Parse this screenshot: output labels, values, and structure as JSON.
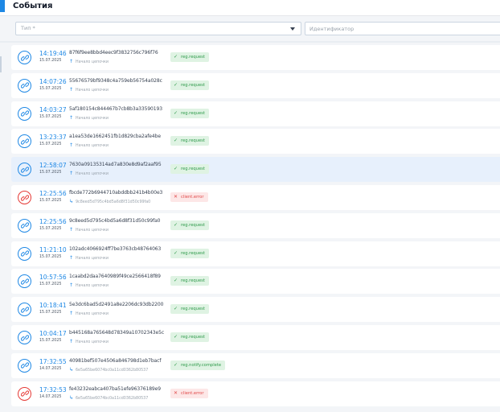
{
  "header": {
    "title": "События"
  },
  "filters": {
    "type_placeholder": "Тип *",
    "id_placeholder": "Идентификатор"
  },
  "colors": {
    "accent": "#1e88e5",
    "error": "#e53935",
    "success_bg": "#dff3e3",
    "error_bg": "#fde7e7"
  },
  "events": [
    {
      "time": "14:19:46",
      "date": "15.07.2025",
      "hash": "87f6f9ee8bbd4eec9f3832756c796f76",
      "sub": "Начало цепочки",
      "sub_kind": "start",
      "badge": "reg.request",
      "status": "ok",
      "icon": "link-icon"
    },
    {
      "time": "14:07:26",
      "date": "15.07.2025",
      "hash": "55676579bf9348c4a759eb56754a028c",
      "sub": "Начало цепочки",
      "sub_kind": "start",
      "badge": "reg.request",
      "status": "ok",
      "icon": "link-icon"
    },
    {
      "time": "14:03:27",
      "date": "15.07.2025",
      "hash": "5af180154c844467b7cb8b3a33590193",
      "sub": "Начало цепочки",
      "sub_kind": "start",
      "badge": "reg.request",
      "status": "ok",
      "icon": "link-icon"
    },
    {
      "time": "13:23:37",
      "date": "15.07.2025",
      "hash": "a1ea53de1662451fb1d829cba2afe4be",
      "sub": "Начало цепочки",
      "sub_kind": "start",
      "badge": "reg.request",
      "status": "ok",
      "icon": "link-icon"
    },
    {
      "time": "12:58:07",
      "date": "15.07.2025",
      "hash": "7630a09135314ad7a830e8d9af2aaf95",
      "sub": "Начало цепочки",
      "sub_kind": "start",
      "badge": "reg.request",
      "status": "ok",
      "icon": "link-icon",
      "selected": true
    },
    {
      "time": "12:25:56",
      "date": "15.07.2025",
      "hash": "fbcde772b6944710abddbb241b4b00e3",
      "sub": "9c8eed5d795c4bd5a6d8f31d50c99fa0",
      "sub_kind": "child",
      "badge": "client.error",
      "status": "error",
      "icon": "link-icon"
    },
    {
      "time": "12:25:56",
      "date": "15.07.2025",
      "hash": "9c8eed5d795c4bd5a6d8f31d50c99fa0",
      "sub": "Начало цепочки",
      "sub_kind": "start",
      "badge": "reg.request",
      "status": "ok",
      "icon": "link-icon"
    },
    {
      "time": "11:21:10",
      "date": "15.07.2025",
      "hash": "102adc4066924ff7be3763cb48764063",
      "sub": "Начало цепочки",
      "sub_kind": "start",
      "badge": "reg.request",
      "status": "ok",
      "icon": "link-icon"
    },
    {
      "time": "10:57:56",
      "date": "15.07.2025",
      "hash": "1caabd2daa7640989f49ce2566418f89",
      "sub": "Начало цепочки",
      "sub_kind": "start",
      "badge": "reg.request",
      "status": "ok",
      "icon": "link-icon"
    },
    {
      "time": "10:18:41",
      "date": "15.07.2025",
      "hash": "5e3dc6bad5d2491a8e2206dc93db2200",
      "sub": "Начало цепочки",
      "sub_kind": "start",
      "badge": "reg.request",
      "status": "ok",
      "icon": "link-icon"
    },
    {
      "time": "10:04:17",
      "date": "15.07.2025",
      "hash": "b445168a765648d78349a10702343e5c",
      "sub": "Начало цепочки",
      "sub_kind": "start",
      "badge": "reg.request",
      "status": "ok",
      "icon": "link-icon"
    },
    {
      "time": "17:32:55",
      "date": "14.07.2025",
      "hash": "40981bef507e4506a846798d1eb7bacf",
      "sub": "6e5a65be6074bc0a11cd0362b80537",
      "sub_kind": "child",
      "badge": "reg.notify.complete",
      "status": "ok",
      "icon": "link-icon"
    },
    {
      "time": "17:32:53",
      "date": "14.07.2025",
      "hash": "fe43232eabca407ba51efe96376189e9",
      "sub": "6e5a65be6074bc0a11cd0362b80537",
      "sub_kind": "child",
      "badge": "client.error",
      "status": "error",
      "icon": "link-icon"
    }
  ]
}
